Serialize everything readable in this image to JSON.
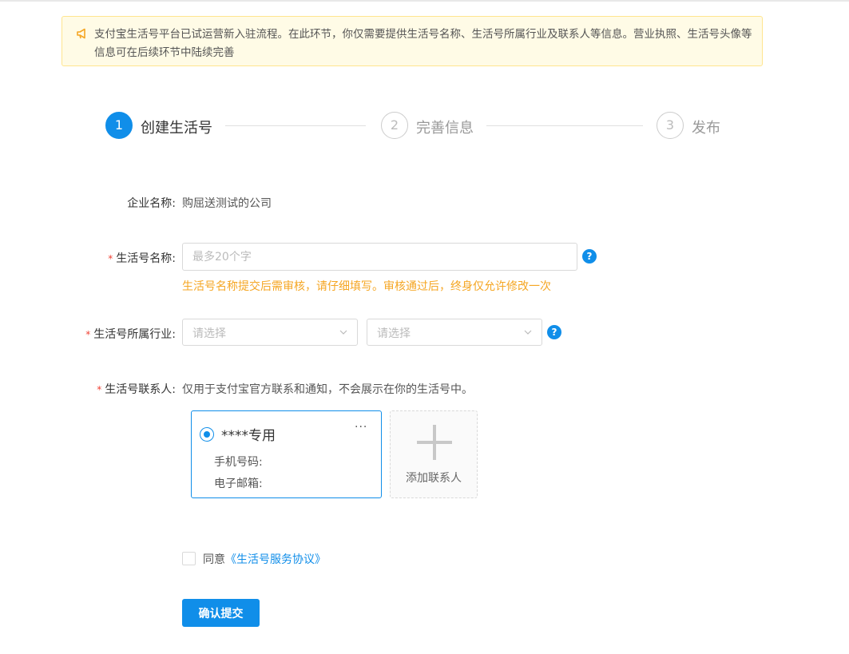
{
  "notice": {
    "text": "支付宝生活号平台已试运营新入驻流程。在此环节，你仅需要提供生活号名称、生活号所属行业及联系人等信息。营业执照、生活号头像等信息可在后续环节中陆续完善",
    "icon": "megaphone-icon",
    "color": "#f5a623"
  },
  "steps": [
    {
      "number": "1",
      "label": "创建生活号",
      "active": true
    },
    {
      "number": "2",
      "label": "完善信息",
      "active": false
    },
    {
      "number": "3",
      "label": "发布",
      "active": false
    }
  ],
  "form": {
    "company": {
      "label": "企业名称:",
      "value": "购屈送测试的公司"
    },
    "name": {
      "required_mark": "*",
      "label": "生活号名称:",
      "placeholder": "最多20个字",
      "hint": "生活号名称提交后需审核，请仔细填写。审核通过后，终身仅允许修改一次"
    },
    "industry": {
      "required_mark": "*",
      "label": "生活号所属行业:",
      "select1": "请选择",
      "select2": "请选择"
    },
    "contact": {
      "required_mark": "*",
      "label": "生活号联系人:",
      "desc": "仅用于支付宝官方联系和通知，不会展示在你的生活号中。"
    }
  },
  "contact_card": {
    "name": "****专用",
    "more": "···",
    "phone_label": "手机号码:",
    "email_label": "电子邮箱:",
    "selected": true
  },
  "add_contact": {
    "label": "添加联系人"
  },
  "agreement": {
    "prefix": "同意",
    "link": "《生活号服务协议》",
    "checked": false
  },
  "submit": {
    "label": "确认提交"
  },
  "help_icon_text": "?",
  "colors": {
    "primary": "#108ee9",
    "warning": "#f5a623",
    "required": "#f04134"
  }
}
